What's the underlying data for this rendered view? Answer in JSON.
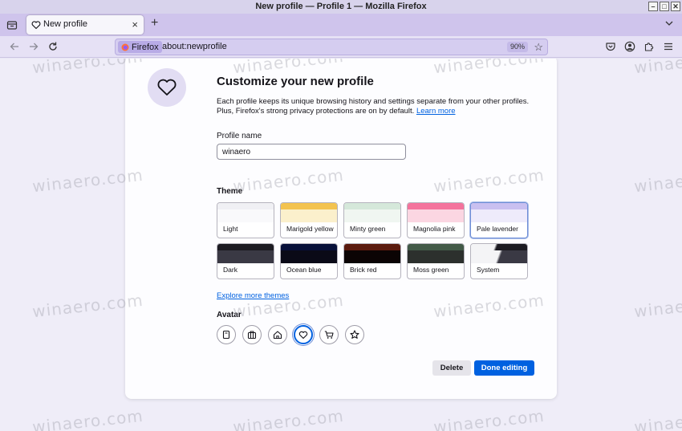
{
  "window": {
    "title": "New profile — Profile 1 — Mozilla Firefox",
    "controls": [
      "–",
      "□",
      "✕"
    ]
  },
  "tabs": [
    {
      "title": "New profile",
      "close": "×"
    }
  ],
  "newtab_label": "+",
  "urlbar": {
    "identity_label": "Firefox",
    "url": "about:newprofile",
    "zoom": "90%",
    "star": "☆"
  },
  "page": {
    "heading": "Customize your new profile",
    "description": "Each profile keeps its unique browsing history and settings separate from your other profiles. Plus, Firefox's strong privacy protections are on by default.",
    "learn_more": "Learn more",
    "profile_name_label": "Profile name",
    "profile_name_value": "winaero",
    "theme_label": "Theme",
    "themes": [
      {
        "name": "Light",
        "top": "#f0f0f4",
        "mid": "#f9f9fb",
        "selected": false
      },
      {
        "name": "Marigold yellow",
        "top": "#f3c34f",
        "mid": "#fbf0cc",
        "selected": false
      },
      {
        "name": "Minty green",
        "top": "#d5e8da",
        "mid": "#f0f6f1",
        "selected": false
      },
      {
        "name": "Magnolia pink",
        "top": "#f4739c",
        "mid": "#fbd6e2",
        "selected": false
      },
      {
        "name": "Pale lavender",
        "top": "#c9c0f0",
        "mid": "#eeebfb",
        "selected": true
      },
      {
        "name": "Dark",
        "top": "#1c1b22",
        "mid": "#3a3944",
        "selected": false
      },
      {
        "name": "Ocean blue",
        "top": "#07103a",
        "mid": "#0a0a17",
        "selected": false
      },
      {
        "name": "Brick red",
        "top": "#5a1a0e",
        "mid": "#0b0404",
        "selected": false
      },
      {
        "name": "Moss green",
        "top": "#425a48",
        "mid": "#2c302d",
        "selected": false
      },
      {
        "name": "System",
        "top": "#1c1b22",
        "mid": "#3a3944",
        "selected": false
      }
    ],
    "explore_themes": "Explore more themes",
    "avatar_label": "Avatar",
    "avatars": [
      "book-icon",
      "briefcase-icon",
      "home-icon",
      "heart-icon",
      "shopping-cart-icon",
      "star-icon"
    ],
    "selected_avatar": "heart-icon",
    "delete_label": "Delete",
    "done_label": "Done editing"
  },
  "watermark": "winaero.com",
  "colors": {
    "accent": "#0061e0",
    "toolbar": "#e6e1f5",
    "tabstrip": "#cfc4ec"
  }
}
